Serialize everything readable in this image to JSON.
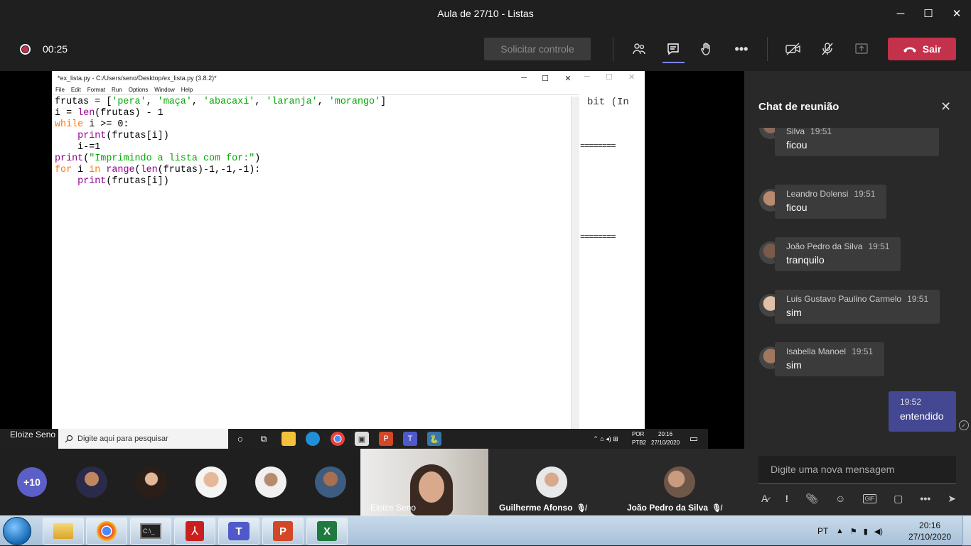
{
  "window": {
    "title": "Aula de 27/10 - Listas",
    "minimize": "─",
    "maximize": "☐",
    "close": "✕"
  },
  "toolbar": {
    "timer": "00:25",
    "request_control": "Solicitar controle",
    "leave": "Sair"
  },
  "editor": {
    "title": "*ex_lista.py - C:/Users/seno/Desktop/ex_lista.py (3.8.2)*",
    "menu": [
      "File",
      "Edit",
      "Format",
      "Run",
      "Options",
      "Window",
      "Help"
    ],
    "code_lines": [
      {
        "parts": [
          [
            "",
            "frutas = ["
          ],
          [
            "st",
            "'pera'"
          ],
          [
            "",
            ", "
          ],
          [
            "st",
            "'maça'"
          ],
          [
            "",
            ", "
          ],
          [
            "st",
            "'abacaxi'"
          ],
          [
            "",
            ", "
          ],
          [
            "st",
            "'laranja'"
          ],
          [
            "",
            ", "
          ],
          [
            "st",
            "'morango'"
          ],
          [
            "",
            "]"
          ]
        ]
      },
      {
        "parts": [
          [
            "",
            "i = "
          ],
          [
            "bi",
            "len"
          ],
          [
            "",
            "(frutas) - 1"
          ]
        ]
      },
      {
        "parts": [
          [
            "kw",
            "while"
          ],
          [
            "",
            " i >= 0:"
          ]
        ]
      },
      {
        "parts": [
          [
            "",
            "    "
          ],
          [
            "bi",
            "print"
          ],
          [
            "",
            "(frutas[i])"
          ]
        ]
      },
      {
        "parts": [
          [
            "",
            "    i-=1"
          ]
        ]
      },
      {
        "parts": [
          [
            "bi",
            "print"
          ],
          [
            "",
            "("
          ],
          [
            "st",
            "\"Imprimindo a lista com for:\""
          ],
          [
            "",
            ")"
          ]
        ]
      },
      {
        "parts": [
          [
            "kw",
            "for"
          ],
          [
            "",
            " i "
          ],
          [
            "kw",
            "in"
          ],
          [
            "",
            " "
          ],
          [
            "bi",
            "range"
          ],
          [
            "",
            "("
          ],
          [
            "bi",
            "len"
          ],
          [
            "",
            "(frutas)-1,-1,-1):"
          ]
        ]
      },
      {
        "parts": [
          [
            "",
            "    "
          ],
          [
            "bi",
            "print"
          ],
          [
            "",
            "(frutas[i])"
          ]
        ]
      }
    ]
  },
  "idle_shell": {
    "text": "bit (In",
    "rule": "========"
  },
  "presenter_label": "Eloize Seno",
  "inner_taskbar": {
    "search_placeholder": "Digite aqui para pesquisar",
    "lang": "POR",
    "layout": "PTB2",
    "time": "20:16",
    "date": "27/10/2020"
  },
  "roster": {
    "overflow": "+10",
    "tiles": [
      {
        "name": "Eloize Seno"
      },
      {
        "name": "Guilherme Afonso"
      },
      {
        "name": "João Pedro da Silva"
      }
    ]
  },
  "chat": {
    "header": "Chat de reunião",
    "messages": [
      {
        "author": "Carlos Eduardo Nunes da Silva",
        "time": "19:51",
        "text": "ficou"
      },
      {
        "author": "Leandro Dolensi",
        "time": "19:51",
        "text": "ficou"
      },
      {
        "author": "João Pedro da Silva",
        "time": "19:51",
        "text": "tranquilo"
      },
      {
        "author": "Luis Gustavo Paulino Carmelo",
        "time": "19:51",
        "text": "sim"
      },
      {
        "author": "Isabella Manoel",
        "time": "19:51",
        "text": "sim"
      }
    ],
    "own_message": {
      "time": "19:52",
      "text": "entendido"
    },
    "compose_placeholder": "Digite uma nova mensagem"
  },
  "win_taskbar": {
    "lang": "PT",
    "time": "20:16",
    "date": "27/10/2020"
  },
  "colors": {
    "leave": "#c4314b",
    "accent": "#7f85f5",
    "own_bubble": "#444791",
    "keyword": "#ff7700",
    "builtin": "#900090",
    "string": "#00aa00"
  }
}
